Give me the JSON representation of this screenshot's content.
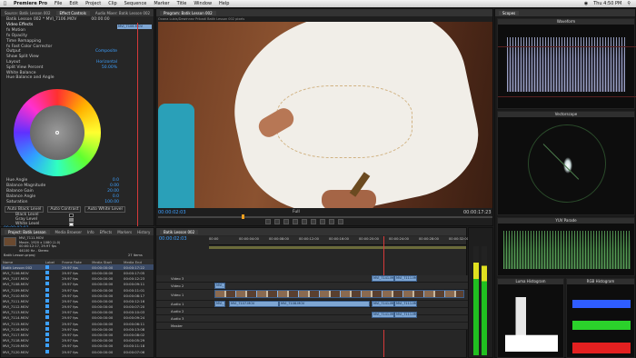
{
  "menubar": {
    "app": "Premiere Pro",
    "items": [
      "File",
      "Edit",
      "Project",
      "Clip",
      "Sequence",
      "Marker",
      "Title",
      "Window",
      "Help"
    ],
    "clock": "Thu 4:50 PM"
  },
  "effect_controls": {
    "tabs": [
      "Source: Batik Lesson 002",
      "Effect Controls",
      "Audio Mixer: Batik Lesson 002"
    ],
    "clip": "Batik Lesson 002 * MVI_7106.MOV",
    "timecode": "00:00:00",
    "clip_bar": "MVI_7106.MOV",
    "section": "Video Effects",
    "rows": [
      {
        "label": "fx Motion",
        "val": ""
      },
      {
        "label": "fx Opacity",
        "val": ""
      },
      {
        "label": "Time Remapping",
        "val": ""
      },
      {
        "label": "fx Fast Color Corrector",
        "val": ""
      },
      {
        "label": "Output",
        "val": "Composite"
      },
      {
        "label": "Show Split View",
        "val": ""
      },
      {
        "label": "Layout",
        "val": "Horizontal"
      },
      {
        "label": "Split View Percent",
        "val": "50.00%"
      },
      {
        "label": "White Balance",
        "val": ""
      },
      {
        "label": "Hue Balance and Angle",
        "val": ""
      }
    ],
    "rows_after": [
      {
        "label": "Hue Angle",
        "val": "0.0"
      },
      {
        "label": "Balance Magnitude",
        "val": "0.00"
      },
      {
        "label": "Balance Gain",
        "val": "20.00"
      },
      {
        "label": "Balance Angle",
        "val": "0.0"
      },
      {
        "label": "Saturation",
        "val": "100.00"
      }
    ],
    "auto_buttons": [
      "Auto Black Level",
      "Auto Contrast",
      "Auto White Level"
    ],
    "levels": [
      "Black Level",
      "Gray Level",
      "White Level"
    ],
    "footer_time": "00:00:02:03"
  },
  "program": {
    "title": "Program: Batik Lesson 002",
    "caption": "Oxana Lubis/Dewinnez Pribadi Batik Lesson 002 pixels",
    "timecode": "00:00:02:03",
    "fit": "Full",
    "duration": "00:00:17:23"
  },
  "project": {
    "tabs": [
      "Project: Batik Lesson",
      "Media Browser",
      "Info",
      "Effects",
      "Markers",
      "History"
    ],
    "clip_name": "MVI_7111.MOV",
    "clip_info1": "Movie, 1920 x 1080 (1.0)",
    "clip_info2": "00:00:12:17, 29.97 fps",
    "clip_info3": "44100 Hz - Stereo",
    "search_path": "Batik Lesson.prproj",
    "items_count": "27 Items",
    "columns": [
      "Name",
      "Label",
      "Frame Rate",
      "Media Start",
      "Media End"
    ],
    "rows": [
      [
        "Batik Lesson 002",
        "",
        "29.97 fps",
        "00:00:00:00",
        "00:00:17:22"
      ],
      [
        "MVI_7106.MOV",
        "",
        "29.97 fps",
        "00:00:00:00",
        "00:00:17:05"
      ],
      [
        "MVI_7107.MOV",
        "",
        "29.97 fps",
        "00:00:00:00",
        "00:00:12:23"
      ],
      [
        "MVI_7108.MOV",
        "",
        "29.97 fps",
        "00:00:00:00",
        "00:00:09:11"
      ],
      [
        "MVI_7109.MOV",
        "",
        "29.97 fps",
        "00:00:00:00",
        "00:00:11:01"
      ],
      [
        "MVI_7110.MOV",
        "",
        "29.97 fps",
        "00:00:00:00",
        "00:00:08:17"
      ],
      [
        "MVI_7111.MOV",
        "",
        "29.97 fps",
        "00:00:00:00",
        "00:00:12:16"
      ],
      [
        "MVI_7112.MOV",
        "",
        "29.97 fps",
        "00:00:00:00",
        "00:00:07:20"
      ],
      [
        "MVI_7113.MOV",
        "",
        "29.97 fps",
        "00:00:00:00",
        "00:00:10:03"
      ],
      [
        "MVI_7114.MOV",
        "",
        "29.97 fps",
        "00:00:00:00",
        "00:00:09:24"
      ],
      [
        "MVI_7115.MOV",
        "",
        "29.97 fps",
        "00:00:00:00",
        "00:00:06:11"
      ],
      [
        "MVI_7116.MOV",
        "",
        "29.97 fps",
        "00:00:00:00",
        "00:00:13:08"
      ],
      [
        "MVI_7117.MOV",
        "",
        "29.97 fps",
        "00:00:00:00",
        "00:00:08:02"
      ],
      [
        "MVI_7118.MOV",
        "",
        "29.97 fps",
        "00:00:00:00",
        "00:00:05:29"
      ],
      [
        "MVI_7119.MOV",
        "",
        "29.97 fps",
        "00:00:00:00",
        "00:00:11:18"
      ],
      [
        "MVI_7120.MOV",
        "",
        "29.97 fps",
        "00:00:00:00",
        "00:00:07:06"
      ]
    ]
  },
  "timeline": {
    "tab": "Batik Lesson 002",
    "timecode": "00:00:02:03",
    "ruler": [
      "00:00",
      "00:00:04:00",
      "00:00:08:00",
      "00:00:12:00",
      "00:00:16:00",
      "00:00:20:00",
      "00:00:24:00",
      "00:00:28:00",
      "00:00:32:00"
    ],
    "tracks": [
      "Video 3",
      "Video 2",
      "Video 1",
      "Audio 1",
      "Audio 2",
      "Audio 3",
      "Master"
    ],
    "clips_top": [
      "MVI_7141.MOV",
      "MVI_7111.MOV"
    ],
    "clips_v2": [
      "MVI_7141.MOV"
    ],
    "clips_a": [
      "MVI_7106.MOV",
      "MVI_7107.MOV",
      "MVI_7108.MOV",
      "MVI_7141.MOV",
      "MVI_7111.MOV"
    ]
  },
  "scopes": {
    "title": "Scopes",
    "waveform": "Waveform",
    "vectorscope": "Vectorscope",
    "yuv": "YUV Parade",
    "luma": "Luma Histogram",
    "rgb": "RGB Histogram"
  },
  "colors": {
    "accent": "#3da0ff",
    "clip": "#7ea6d3",
    "playhead": "#d63a3a"
  }
}
